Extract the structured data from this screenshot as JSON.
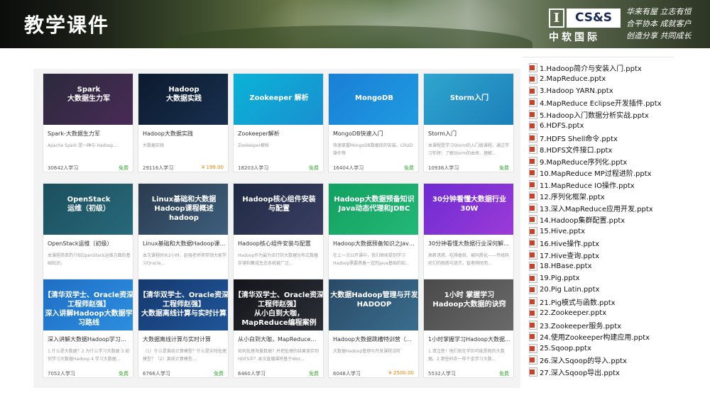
{
  "header": {
    "title": "教学课件",
    "logo_letter": "I",
    "logo_box": "CS&S",
    "logo_cn": "中软国际",
    "slogan": [
      "华来有屋 立志有恒",
      "合平协本 成就客户",
      "创造分享 共同成长"
    ]
  },
  "courses": [
    {
      "thumb": "Spark\n大数据生力军",
      "title": "Spark-大数据生力军",
      "desc": "Apache Spark 是一种与 Hadoop...",
      "learners": "30642人学习",
      "price": "免费",
      "paid": false,
      "bg": "linear-gradient(135deg,#2a2a3c,#4a2a56)"
    },
    {
      "thumb": "Hadoop\n大数据实践",
      "title": "Hadoop大数据实践",
      "desc": "大数据实践",
      "learners": "29116人学习",
      "price": "¥ 199.00",
      "paid": true,
      "bg": "linear-gradient(135deg,#0d1a2e,#18304f)"
    },
    {
      "thumb": "Zookeeper 解析",
      "title": "Zookeeper解析",
      "desc": "Zookeeper解析",
      "learners": "18203人学习",
      "price": "免费",
      "paid": false,
      "bg": "linear-gradient(135deg,#0ab3d6,#1a8fd1)"
    },
    {
      "thumb": "MongoDB",
      "title": "MongoDB快速入门",
      "desc": "快速掌握MongoDB数据库的安装、CRUD操作等",
      "learners": "16404人学习",
      "price": "免费",
      "paid": false,
      "bg": "linear-gradient(135deg,#1a7fd6,#1f9be0)"
    },
    {
      "thumb": "Storm入门",
      "title": "Storm入门",
      "desc": "本课程是学习Storm的入门级课程，通过学习你将：了解Storm的由来、理解...",
      "learners": "10936人学习",
      "price": "免费",
      "paid": false,
      "bg": "linear-gradient(135deg,#2fa6cf,#1c7fb9)"
    },
    {
      "thumb": "OpenStack\n运维（初级）",
      "title": "OpenStack运维（初级）",
      "desc": "本课程简单的介绍OpenStack运维方面的基础知识。",
      "learners": "",
      "price": "",
      "paid": false,
      "bg": "linear-gradient(135deg,#1c4f5e,#27697a)"
    },
    {
      "thumb": "Linux基础和大数据Hadoop课程概述\nhadoop",
      "title": "Linux基础和大数据Hadoop课程...",
      "desc": "本次课程时长2小时，赵强老师将带领大家学习Oracle...",
      "learners": "",
      "price": "",
      "paid": false,
      "bg": "linear-gradient(135deg,#2a3b4e,#3e5f7e)"
    },
    {
      "thumb": "Hadoop核心组件安装\n与配置",
      "title": "Hadoop核心组件安装与配置",
      "desc": "Hadoop作为最为流行的大数据分布式数据存储和集成生态系统被广泛...",
      "learners": "",
      "price": "",
      "paid": false,
      "bg": "linear-gradient(135deg,#1f2a44,#3b3f63)"
    },
    {
      "thumb": "Hadoop大数据预备知识\nJava动态代理和JDBC",
      "title": "Hadoop大数据预备知识之Java...",
      "desc": "在上一次公开课中，我们继续提到学习Hadoop需要具备一定的Java基础的知...",
      "learners": "",
      "price": "",
      "paid": false,
      "bg": "linear-gradient(135deg,#13a061,#23b876)"
    },
    {
      "thumb": "30分钟看懂大数据行业\n30W",
      "title": "30分钟看懂大数据行业深何解...",
      "desc": "高薪诱惑、吃得香就、被同质化——传统码农们的困惑与迷茫。智者顺时而...",
      "learners": "",
      "price": "",
      "paid": false,
      "bg": "linear-gradient(135deg,#6d2bd1,#9c3bd8)"
    },
    {
      "thumb": "【清华双学士、Oracle资深工程师赵强】\n深入讲解Hadoop大数据学习路线",
      "title": "深入讲解大数据Hadoop学习路线",
      "desc": "1.什么是大数据？2.为什么学习大数据 3.如何学习大数据Hadoop 4.学习大数据...",
      "learners": "7052人学习",
      "price": "免费",
      "paid": false,
      "bg": "linear-gradient(135deg,#1f6fc4,#2d8ee0)"
    },
    {
      "thumb": "【清华双学士、Oracle资深工程师赵强】\n大数据离线计算与实时计算",
      "title": "大数据离线计算与实时计算",
      "desc": "（1）什么是离线计算模型？什么是实时处理模型？（2）离线计算模型...",
      "learners": "6766人学习",
      "price": "免费",
      "paid": false,
      "bg": "linear-gradient(135deg,#163a6e,#1f5599)"
    },
    {
      "thumb": "【清华双学士、Oracle资深工程师赵强】\n从小白到大咖，MapReduce编程案例",
      "title": "从小白到大咖，MapReduce编...",
      "desc": "如何处理海量数据？并把处理的结果保存到HDFS中？本次直播课将基于Wor...",
      "learners": "6460人学习",
      "price": "免费",
      "paid": false,
      "bg": "linear-gradient(135deg,#14161a,#2a2e36)"
    },
    {
      "thumb": "大数据Hadoop管理与开发\nHADOOP",
      "title": "Hadoop大数据跳槽特训营（报...",
      "desc": "大数据Hadoop管理与开发课程试听",
      "learners": "6048人学习",
      "price": "¥ 2500.00",
      "paid": true,
      "bg": "linear-gradient(135deg,#2a4a66,#3a6e8e)"
    },
    {
      "thumb": "1小时 掌握学习\nHadoop大数据的诀窍",
      "title": "1小时掌握学习Hadoop大数据...",
      "desc": "1.请注意！他们就在学的可能是假的大数据。2.那些码农一样千金学习大数...",
      "learners": "5532人学习",
      "price": "免费",
      "paid": false,
      "bg": "linear-gradient(135deg,#4a4a4a,#6a6a6a)"
    }
  ],
  "files": [
    "1.Hadoop简介与安装入门.pptx",
    "2.MapReduce.pptx",
    "3.Hadoop YARN.pptx",
    "4.MapReduce Eclipse开发插件.pptx",
    "5.Hadoop入门数据分析实战.pptx",
    "6.HDFS.pptx",
    "7.HDFS Shell命令.pptx",
    "8.HDFS文件接口.pptx",
    "9.MapReduce序列化.pptx",
    "10.MapReduce MP过程进阶.pptx",
    "11.MapReduce IO操作.pptx",
    "12.序列化框架.pptx",
    "13.深入MapReduce应用开发.pptx",
    "14.Hadoop集群配置.pptx",
    "15.Hive.pptx",
    "16.Hive操作.pptx",
    "17.Hive查询.pptx",
    "18.HBase.pptx",
    "19.Pig.pptx",
    "20.Pig Latin.pptx",
    "21.Pig模式与函数.pptx",
    "22.Zookeeper.pptx",
    "23.Zookeeper服务.pptx",
    "24.使用Zookeeper构建应用.pptx",
    "25.Sqoop.pptx",
    "26.深入Sqoop的导入.pptx",
    "27.深入Sqoop导出.pptx"
  ]
}
